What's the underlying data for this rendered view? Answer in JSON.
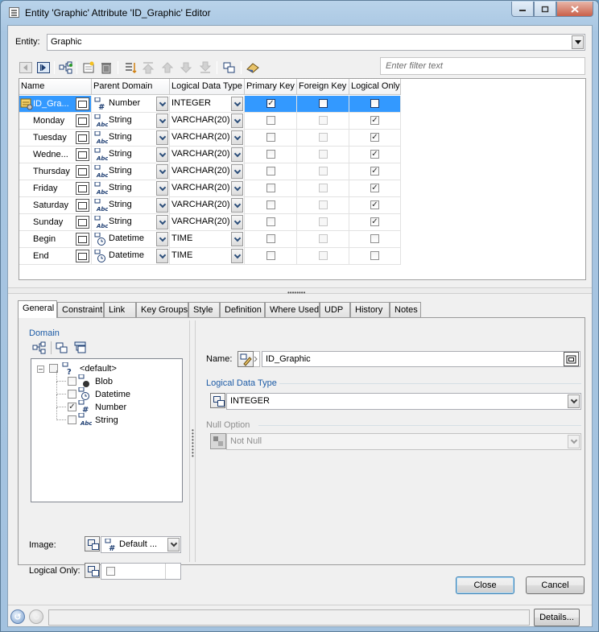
{
  "window": {
    "title": "Entity 'Graphic' Attribute 'ID_Graphic' Editor",
    "controls": [
      "minimize-icon",
      "maximize-icon",
      "close-icon"
    ]
  },
  "entity": {
    "label": "Entity:",
    "value": "Graphic"
  },
  "toolbar": {
    "icons": [
      "nav-first-icon",
      "nav-last-icon",
      "hierarchy-icon",
      "new-attribute-icon",
      "delete-icon",
      "reorder-icon",
      "move-top-icon",
      "move-up-icon",
      "move-down-icon",
      "move-bottom-icon",
      "domain-icon",
      "eraser-icon"
    ],
    "filter_placeholder": "Enter filter text"
  },
  "grid": {
    "columns": [
      "Name",
      "Parent Domain",
      "Logical Data Type",
      "Primary Key",
      "Foreign Key",
      "Logical Only"
    ],
    "rows": [
      {
        "name": "ID_Gra...",
        "domain": "Number",
        "domain_icon": "#",
        "type": "INTEGER",
        "pk": true,
        "fk": false,
        "lo": false,
        "selected": true
      },
      {
        "name": "Monday",
        "domain": "String",
        "domain_icon": "abc",
        "type": "VARCHAR(20)",
        "pk": false,
        "fk": false,
        "lo": true,
        "selected": false
      },
      {
        "name": "Tuesday",
        "domain": "String",
        "domain_icon": "abc",
        "type": "VARCHAR(20)",
        "pk": false,
        "fk": false,
        "lo": true,
        "selected": false
      },
      {
        "name": "Wedne...",
        "domain": "String",
        "domain_icon": "abc",
        "type": "VARCHAR(20)",
        "pk": false,
        "fk": false,
        "lo": true,
        "selected": false
      },
      {
        "name": "Thursday",
        "domain": "String",
        "domain_icon": "abc",
        "type": "VARCHAR(20)",
        "pk": false,
        "fk": false,
        "lo": true,
        "selected": false
      },
      {
        "name": "Friday",
        "domain": "String",
        "domain_icon": "abc",
        "type": "VARCHAR(20)",
        "pk": false,
        "fk": false,
        "lo": true,
        "selected": false
      },
      {
        "name": "Saturday",
        "domain": "String",
        "domain_icon": "abc",
        "type": "VARCHAR(20)",
        "pk": false,
        "fk": false,
        "lo": true,
        "selected": false
      },
      {
        "name": "Sunday",
        "domain": "String",
        "domain_icon": "abc",
        "type": "VARCHAR(20)",
        "pk": false,
        "fk": false,
        "lo": true,
        "selected": false
      },
      {
        "name": "Begin",
        "domain": "Datetime",
        "domain_icon": "clock",
        "type": "TIME",
        "pk": false,
        "fk": false,
        "lo": false,
        "selected": false
      },
      {
        "name": "End",
        "domain": "Datetime",
        "domain_icon": "clock",
        "type": "TIME",
        "pk": false,
        "fk": false,
        "lo": false,
        "selected": false
      }
    ]
  },
  "tabs": [
    "General",
    "Constraint",
    "Link",
    "Key Groups",
    "Style",
    "Definition",
    "Where Used",
    "UDP",
    "History",
    "Notes"
  ],
  "active_tab": "General",
  "general": {
    "domain_header": "Domain",
    "tree": {
      "root": "<default>",
      "children": [
        {
          "label": "Blob",
          "checked": false
        },
        {
          "label": "Datetime",
          "checked": false
        },
        {
          "label": "Number",
          "checked": true
        },
        {
          "label": "String",
          "checked": false
        }
      ]
    },
    "image_label": "Image:",
    "image_value": "Default ...",
    "logical_only_label": "Logical Only:",
    "name_label": "Name:",
    "name_value": "ID_Graphic",
    "ldt_header": "Logical Data Type",
    "ldt_value": "INTEGER",
    "null_header": "Null Option",
    "null_value": "Not Null"
  },
  "buttons": {
    "close": "Close",
    "cancel": "Cancel",
    "details": "Details..."
  },
  "colors": {
    "selection": "#3399ff",
    "section_header": "#1c5ba6"
  }
}
